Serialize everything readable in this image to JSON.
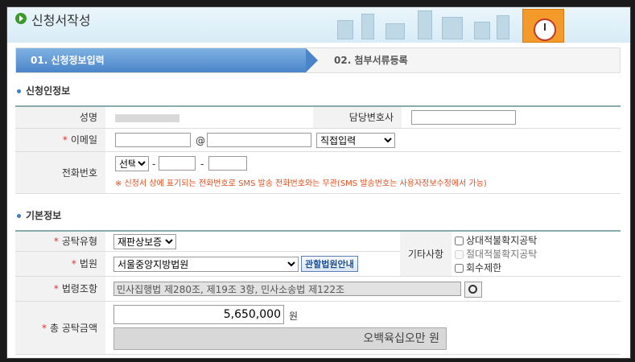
{
  "header": {
    "title": "신청서작성"
  },
  "steps": [
    {
      "label": "01. 신청정보입력"
    },
    {
      "label": "02. 첨부서류등록"
    }
  ],
  "applicant": {
    "heading": "신청인정보",
    "name_label": "성명",
    "officer_label": "담당변호사",
    "email_label": "이메일",
    "email_at": "@",
    "email_domain_select": "직접입력",
    "phone_label": "전화번호",
    "phone_select": "선택",
    "phone_dash": "-",
    "phone_note": "※ 신청서 상에 표기되는 전화번호로 SMS 발송 전화번호와는 무관(SMS 발송번호는 사용자정보수정에서 가능)"
  },
  "basic": {
    "heading": "기본정보",
    "deposit_type_label": "공탁유형",
    "deposit_type_value": "재판상보증",
    "court_label": "법원",
    "court_value": "서울중앙지방법원",
    "court_guide_button": "관할법원안내",
    "misc_label": "기타사항",
    "misc_options": [
      "상대적불확지공탁",
      "절대적불확지공탁",
      "회수제한"
    ],
    "law_label": "법령조항",
    "law_value": "민사집행법 제280조, 제19조 3항, 민사소송법 제122조",
    "amount_label": "총 공탁금액",
    "amount_value": "5,650,000",
    "amount_unit": "원",
    "amount_korean": "오백육십오만 원"
  },
  "required_mark": "*"
}
